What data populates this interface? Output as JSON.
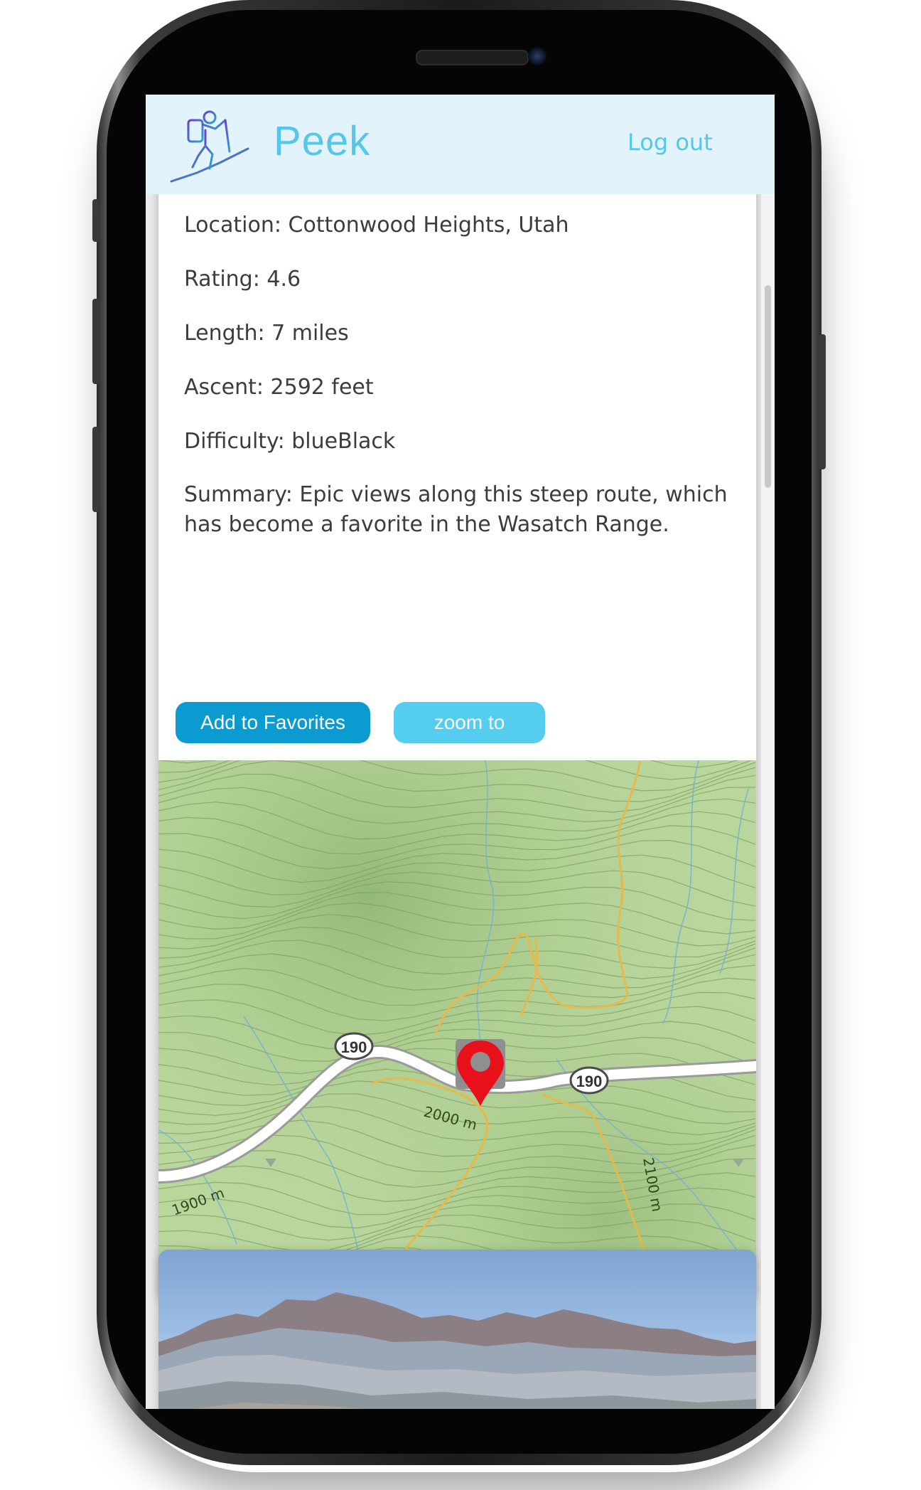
{
  "app": {
    "brand": "Peek",
    "logout_label": "Log out"
  },
  "trail": {
    "location": "Location: Cottonwood Heights, Utah",
    "rating": "Rating: 4.6",
    "length": "Length: 7 miles",
    "ascent": "Ascent: 2592 feet",
    "difficulty": "Difficulty: blueBlack",
    "summary": "Summary: Epic views along this steep route, which has become a favorite in the Wasatch Range."
  },
  "actions": {
    "favorites_label": "Add to Favorites",
    "zoom_label": "zoom to"
  },
  "map": {
    "route_shield_left": "190",
    "route_shield_right": "190",
    "contour_2000": "2000 m",
    "contour_2100": "2100 m",
    "contour_1900": "1900 m"
  },
  "icons": {
    "logo": "hiker-icon",
    "marker": "map-pin-icon"
  },
  "colors": {
    "header_bg": "#e2f3fb",
    "brand": "#55c8ea",
    "favorites_button": "#0b9bd1",
    "zoom_button": "#55cdf0",
    "map_pin": "#e8101a"
  }
}
